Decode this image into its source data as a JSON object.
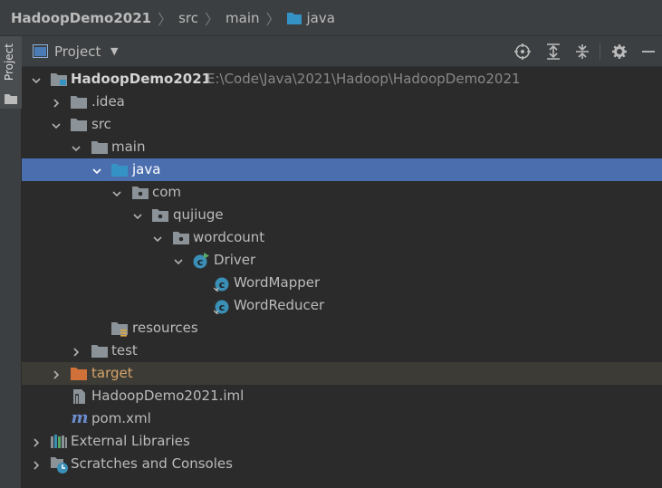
{
  "breadcrumb": [
    "HadoopDemo2021",
    "src",
    "main",
    "java"
  ],
  "sidebar": {
    "project_tab_label": "Project"
  },
  "panel": {
    "title": "Project",
    "tools": [
      "locate-icon",
      "expand-all-icon",
      "collapse-all-icon",
      "gear-icon",
      "minimize-icon"
    ]
  },
  "tree": {
    "root": {
      "name": "HadoopDemo2021",
      "path": "E:\\Code\\Java\\2021\\Hadoop\\HadoopDemo2021"
    },
    "idea": ".idea",
    "src": "src",
    "main": "main",
    "java": "java",
    "com": "com",
    "qujiuge": "qujiuge",
    "wordcount": "wordcount",
    "driver": "Driver",
    "mapper": "WordMapper",
    "reducer": "WordReducer",
    "resources": "resources",
    "test": "test",
    "target": "target",
    "iml": "HadoopDemo2021.iml",
    "pom": "pom.xml",
    "external_libraries": "External Libraries",
    "scratches": "Scratches and Consoles"
  },
  "colors": {
    "selection": "#4b6eaf",
    "target_highlight": "#3d3b35",
    "folder_gray": "#8b9298",
    "folder_blue": "#3592c4",
    "folder_orange": "#d1713a",
    "class_teal": "#3a8fb7",
    "maven_blue": "#6b8ccf"
  }
}
